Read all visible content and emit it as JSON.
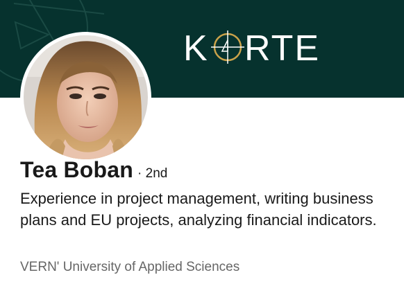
{
  "banner": {
    "brand": "KORTE",
    "brand_letters": [
      "K",
      "RTE"
    ],
    "background_color": "#06322e",
    "logo_color": "#ffffff",
    "logo_accent_color": "#c9a24a"
  },
  "profile": {
    "name": "Tea Boban",
    "degree": "· 2nd",
    "headline": "Experience in project management, writing business plans and EU projects, analyzing financial indicators.",
    "education": "VERN' University of Applied Sciences",
    "avatar_icon": "profile-photo"
  }
}
